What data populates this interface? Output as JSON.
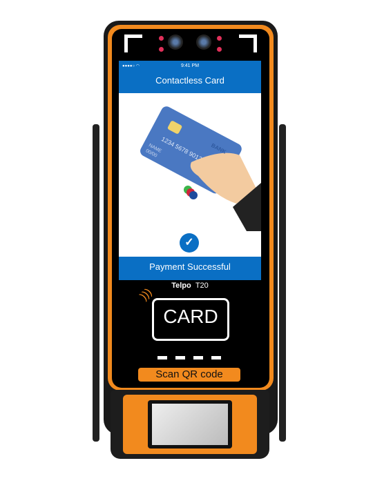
{
  "screen": {
    "status_time": "9:41 PM",
    "title": "Contactless Card",
    "card": {
      "number": "1234 5678 9012",
      "name": "NAME",
      "expiry": "00/00",
      "bank": "BANK"
    },
    "result": "Payment Successful"
  },
  "device": {
    "brand": "Telpo",
    "model": "T20",
    "card_label": "CARD",
    "qr_label": "Scan QR code"
  },
  "colors": {
    "accent": "#f28a1e",
    "screen_blue": "#0a6fc4"
  }
}
